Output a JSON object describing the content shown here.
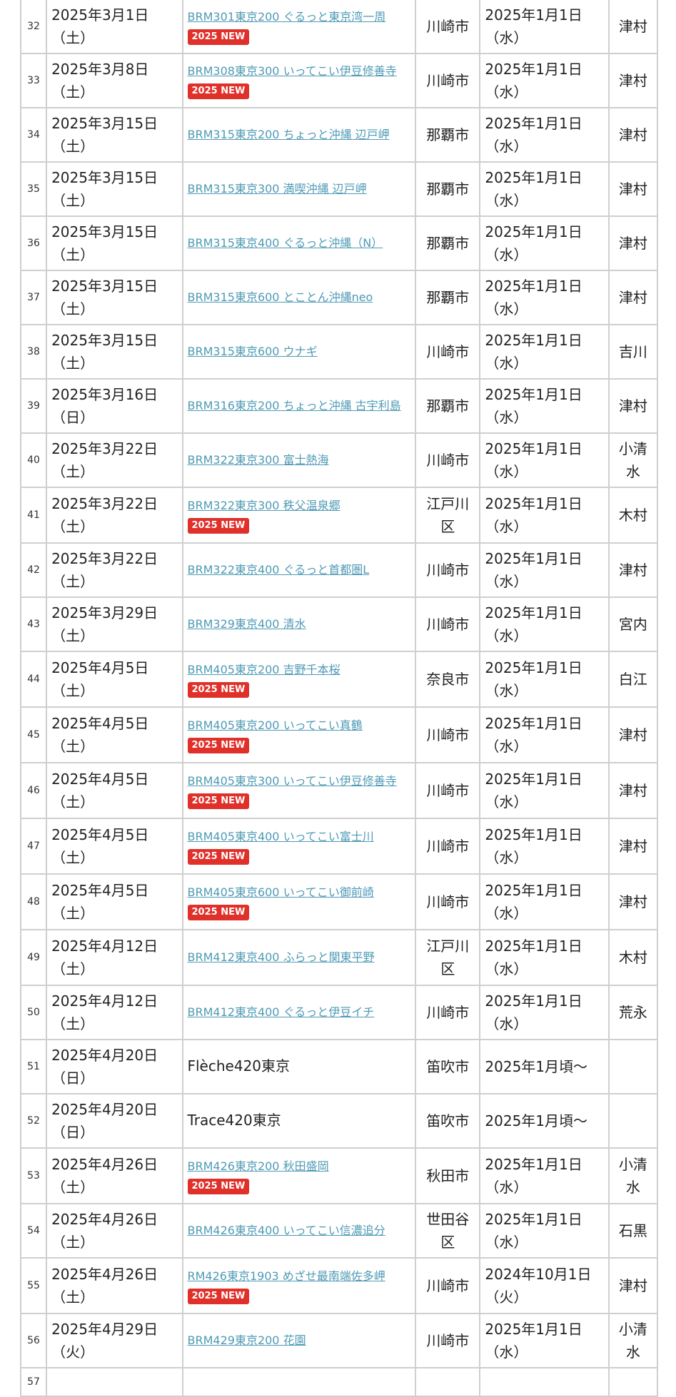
{
  "rows": [
    {
      "no": "32",
      "date": [
        "2025年3月1日",
        "（土）"
      ],
      "event": "BRM301東京200 ぐるっと東京湾一周",
      "link": true,
      "badge": "2025 NEW",
      "city": [
        "川崎市"
      ],
      "start": [
        "2025年1月1日",
        "（水）"
      ],
      "staff": [
        "津村"
      ]
    },
    {
      "no": "33",
      "date": [
        "2025年3月8日",
        "（土）"
      ],
      "event": "BRM308東京300 いってこい伊豆修善寺",
      "link": true,
      "badge": "2025 NEW",
      "city": [
        "川崎市"
      ],
      "start": [
        "2025年1月1日",
        "（水）"
      ],
      "staff": [
        "津村"
      ]
    },
    {
      "no": "34",
      "date": [
        "2025年3月15日",
        "（土）"
      ],
      "event": "BRM315東京200 ちょっと沖縄 辺戸岬",
      "link": true,
      "badge": "",
      "city": [
        "那覇市"
      ],
      "start": [
        "2025年1月1日",
        "（水）"
      ],
      "staff": [
        "津村"
      ]
    },
    {
      "no": "35",
      "date": [
        "2025年3月15日",
        "（土）"
      ],
      "event": "BRM315東京300 満喫沖縄 辺戸岬",
      "link": true,
      "badge": "",
      "city": [
        "那覇市"
      ],
      "start": [
        "2025年1月1日",
        "（水）"
      ],
      "staff": [
        "津村"
      ]
    },
    {
      "no": "36",
      "date": [
        "2025年3月15日",
        "（土）"
      ],
      "event": "BRM315東京400 ぐるっと沖縄（N）",
      "link": true,
      "badge": "",
      "city": [
        "那覇市"
      ],
      "start": [
        "2025年1月1日",
        "（水）"
      ],
      "staff": [
        "津村"
      ]
    },
    {
      "no": "37",
      "date": [
        "2025年3月15日",
        "（土）"
      ],
      "event": "BRM315東京600 とことん沖縄neo",
      "link": true,
      "badge": "",
      "city": [
        "那覇市"
      ],
      "start": [
        "2025年1月1日",
        "（水）"
      ],
      "staff": [
        "津村"
      ]
    },
    {
      "no": "38",
      "date": [
        "2025年3月15日",
        "（土）"
      ],
      "event": "BRM315東京600 ウナギ",
      "link": true,
      "badge": "",
      "city": [
        "川崎市"
      ],
      "start": [
        "2025年1月1日",
        "（水）"
      ],
      "staff": [
        "吉川"
      ]
    },
    {
      "no": "39",
      "date": [
        "2025年3月16日",
        "（日）"
      ],
      "event": "BRM316東京200 ちょっと沖縄 古宇利島",
      "link": true,
      "badge": "",
      "city": [
        "那覇市"
      ],
      "start": [
        "2025年1月1日",
        "（水）"
      ],
      "staff": [
        "津村"
      ]
    },
    {
      "no": "40",
      "date": [
        "2025年3月22日",
        "（土）"
      ],
      "event": "BRM322東京300 富士熱海",
      "link": true,
      "badge": "",
      "city": [
        "川崎市"
      ],
      "start": [
        "2025年1月1日",
        "（水）"
      ],
      "staff": [
        "小清",
        "水"
      ]
    },
    {
      "no": "41",
      "date": [
        "2025年3月22日",
        "（土）"
      ],
      "event": "BRM322東京300 秩父温泉郷",
      "link": true,
      "badge": "2025 NEW",
      "city": [
        "江戸川",
        "区"
      ],
      "start": [
        "2025年1月1日",
        "（水）"
      ],
      "staff": [
        "木村"
      ]
    },
    {
      "no": "42",
      "date": [
        "2025年3月22日",
        "（土）"
      ],
      "event": "BRM322東京400 ぐるっと首都圏L",
      "link": true,
      "badge": "",
      "city": [
        "川崎市"
      ],
      "start": [
        "2025年1月1日",
        "（水）"
      ],
      "staff": [
        "津村"
      ]
    },
    {
      "no": "43",
      "date": [
        "2025年3月29日",
        "（土）"
      ],
      "event": "BRM329東京400 清水",
      "link": true,
      "badge": "",
      "city": [
        "川崎市"
      ],
      "start": [
        "2025年1月1日",
        "（水）"
      ],
      "staff": [
        "宮内"
      ]
    },
    {
      "no": "44",
      "date": [
        "2025年4月5日",
        "（土）"
      ],
      "event": "BRM405東京200 吉野千本桜",
      "link": true,
      "badge": "2025 NEW",
      "city": [
        "奈良市"
      ],
      "start": [
        "2025年1月1日",
        "（水）"
      ],
      "staff": [
        "白江"
      ]
    },
    {
      "no": "45",
      "date": [
        "2025年4月5日",
        "（土）"
      ],
      "event": "BRM405東京200 いってこい真鶴",
      "link": true,
      "badge": "2025 NEW",
      "city": [
        "川崎市"
      ],
      "start": [
        "2025年1月1日",
        "（水）"
      ],
      "staff": [
        "津村"
      ]
    },
    {
      "no": "46",
      "date": [
        "2025年4月5日",
        "（土）"
      ],
      "event": "BRM405東京300 いってこい伊豆修善寺",
      "link": true,
      "badge": "2025 NEW",
      "city": [
        "川崎市"
      ],
      "start": [
        "2025年1月1日",
        "（水）"
      ],
      "staff": [
        "津村"
      ]
    },
    {
      "no": "47",
      "date": [
        "2025年4月5日",
        "（土）"
      ],
      "event": "BRM405東京400 いってこい富士川",
      "link": true,
      "badge": "2025 NEW",
      "city": [
        "川崎市"
      ],
      "start": [
        "2025年1月1日",
        "（水）"
      ],
      "staff": [
        "津村"
      ]
    },
    {
      "no": "48",
      "date": [
        "2025年4月5日",
        "（土）"
      ],
      "event": "BRM405東京600 いってこい御前崎",
      "link": true,
      "badge": "2025 NEW",
      "city": [
        "川崎市"
      ],
      "start": [
        "2025年1月1日",
        "（水）"
      ],
      "staff": [
        "津村"
      ]
    },
    {
      "no": "49",
      "date": [
        "2025年4月12日",
        "（土）"
      ],
      "event": "BRM412東京400 ふらっと関東平野",
      "link": true,
      "badge": "",
      "city": [
        "江戸川",
        "区"
      ],
      "start": [
        "2025年1月1日",
        "（水）"
      ],
      "staff": [
        "木村"
      ]
    },
    {
      "no": "50",
      "date": [
        "2025年4月12日",
        "（土）"
      ],
      "event": "BRM412東京400 ぐるっと伊豆イチ",
      "link": true,
      "badge": "",
      "city": [
        "川崎市"
      ],
      "start": [
        "2025年1月1日",
        "（水）"
      ],
      "staff": [
        "荒永"
      ]
    },
    {
      "no": "51",
      "date": [
        "2025年4月20日",
        "（日）"
      ],
      "event": "Flèche420東京",
      "link": false,
      "badge": "",
      "city": [
        "笛吹市"
      ],
      "start": [
        "2025年1月頃〜"
      ],
      "staff": []
    },
    {
      "no": "52",
      "date": [
        "2025年4月20日",
        "（日）"
      ],
      "event": "Trace420東京",
      "link": false,
      "badge": "",
      "city": [
        "笛吹市"
      ],
      "start": [
        "2025年1月頃〜"
      ],
      "staff": []
    },
    {
      "no": "53",
      "date": [
        "2025年4月26日",
        "（土）"
      ],
      "event": "BRM426東京200 秋田盛岡",
      "link": true,
      "badge": "2025 NEW",
      "city": [
        "秋田市"
      ],
      "start": [
        "2025年1月1日",
        "（水）"
      ],
      "staff": [
        "小清",
        "水"
      ]
    },
    {
      "no": "54",
      "date": [
        "2025年4月26日",
        "（土）"
      ],
      "event": "BRM426東京400 いってこい信濃追分",
      "link": true,
      "badge": "",
      "city": [
        "世田谷",
        "区"
      ],
      "start": [
        "2025年1月1日",
        "（水）"
      ],
      "staff": [
        "石黒"
      ]
    },
    {
      "no": "55",
      "date": [
        "2025年4月26日",
        "（土）"
      ],
      "event": "RM426東京1903 めざせ最南端佐多岬",
      "link": true,
      "badge": "2025 NEW",
      "city": [
        "川崎市"
      ],
      "start": [
        "2024年10月1日",
        "（火）"
      ],
      "staff": [
        "津村"
      ]
    },
    {
      "no": "56",
      "date": [
        "2025年4月29日",
        "（火）"
      ],
      "event": "BRM429東京200 花園",
      "link": true,
      "badge": "",
      "city": [
        "川崎市"
      ],
      "start": [
        "2025年1月1日",
        "（水）"
      ],
      "staff": [
        "小清",
        "水"
      ]
    },
    {
      "no": "57",
      "date": [],
      "event": "",
      "link": false,
      "badge": "",
      "city": [],
      "start": [],
      "staff": []
    }
  ],
  "colors": {
    "link": "#4e9ab5",
    "badge": "#e0302a",
    "border": "#cfcfcf"
  }
}
